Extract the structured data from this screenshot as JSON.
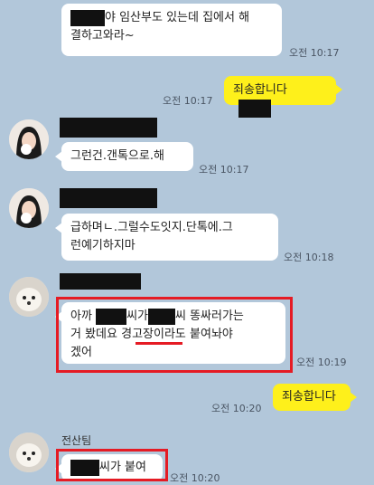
{
  "messages": {
    "m1": {
      "line1": "야 임산부도 있는데 집에서 해",
      "line2": "결하고와라~",
      "time": "오전 10:17"
    },
    "m2": {
      "text": "죄송합니다",
      "time": "오전 10:17"
    },
    "m3": {
      "text": "그런건.갠톡으로.해",
      "time": "오전 10:17"
    },
    "m4": {
      "line1": "급하며ㄴ.그럴수도잇지.단톡에.그",
      "line2": "런예기하지마",
      "time": "오전 10:18"
    },
    "m5": {
      "l1a": "아까",
      "l1b": "씨가",
      "l1c": "씨 똥싸러가는",
      "l2a": "거 봤데요",
      "l2b": "경고장",
      "l2c": "이라도 붙여놔야",
      "l3": "겠어",
      "time": "오전 10:19"
    },
    "m6": {
      "text": "죄송합니다",
      "time": "오전 10:20"
    },
    "m7": {
      "sender": "전산팀",
      "text": "씨가 붙여",
      "time": "오전 10:20"
    }
  },
  "colors": {
    "background": "#b2c7da",
    "my_bubble": "#fef01b",
    "highlight": "#e51b24"
  }
}
